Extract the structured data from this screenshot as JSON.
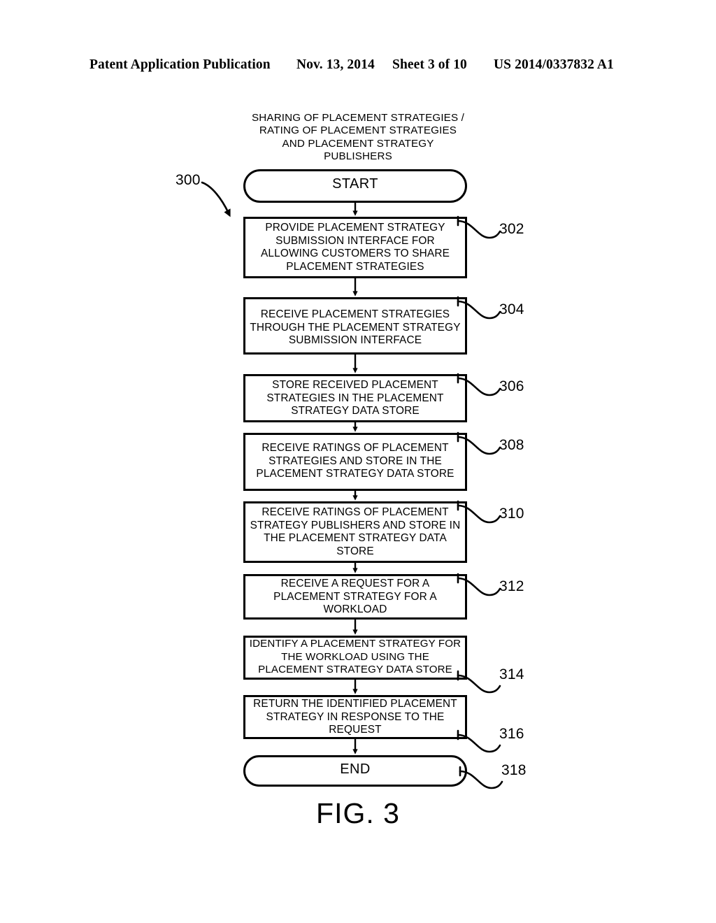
{
  "header": {
    "publication": "Patent Application Publication",
    "date": "Nov. 13, 2014",
    "sheet": "Sheet 3 of 10",
    "patent_number": "US 2014/0337832 A1"
  },
  "figure": {
    "caption": "FIG. 3",
    "title": "SHARING OF PLACEMENT STRATEGIES /\nRATING OF PLACEMENT STRATEGIES\nAND PLACEMENT STRATEGY\nPUBLISHERS",
    "diagram_ref": "300",
    "line_color": "#000000",
    "background": "#ffffff"
  },
  "flowchart": {
    "start": {
      "label": "START",
      "ref": ""
    },
    "end": {
      "label": "END",
      "ref": "318"
    },
    "steps": [
      {
        "ref": "302",
        "label": "PROVIDE PLACEMENT STRATEGY\nSUBMISSION INTERFACE FOR\nALLOWING CUSTOMERS TO SHARE\nPLACEMENT STRATEGIES"
      },
      {
        "ref": "304",
        "label": "RECEIVE PLACEMENT STRATEGIES\nTHROUGH THE PLACEMENT STRATEGY\nSUBMISSION INTERFACE"
      },
      {
        "ref": "306",
        "label": "STORE RECEIVED PLACEMENT\nSTRATEGIES IN THE PLACEMENT\nSTRATEGY DATA STORE"
      },
      {
        "ref": "308",
        "label": "RECEIVE RATINGS OF PLACEMENT\nSTRATEGIES AND STORE IN THE\nPLACEMENT STRATEGY DATA STORE"
      },
      {
        "ref": "310",
        "label": "RECEIVE RATINGS OF PLACEMENT\nSTRATEGY PUBLISHERS AND STORE IN\nTHE PLACEMENT STRATEGY DATA\nSTORE"
      },
      {
        "ref": "312",
        "label": "RECEIVE A REQUEST FOR A\nPLACEMENT STRATEGY FOR A\nWORKLOAD"
      },
      {
        "ref": "314",
        "label": "IDENTIFY A PLACEMENT STRATEGY FOR\nTHE WORKLOAD USING THE\nPLACEMENT STRATEGY DATA STORE"
      },
      {
        "ref": "316",
        "label": "RETURN THE IDENTIFIED PLACEMENT\nSTRATEGY IN RESPONSE TO THE\nREQUEST"
      }
    ]
  }
}
